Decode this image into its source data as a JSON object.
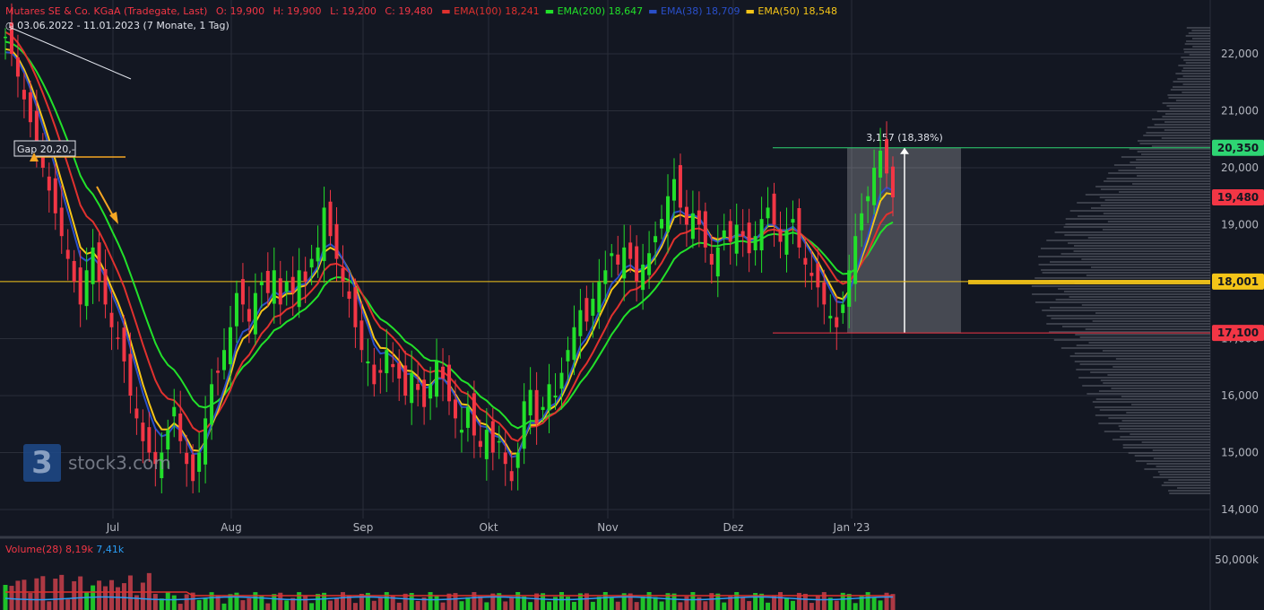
{
  "header": {
    "title": "Mutares SE & Co. KGaA (Tradegate, Last)",
    "open": "O: 19,900",
    "high": "H: 19,900",
    "low": "L: 19,200",
    "close": "C: 19,480",
    "indicators": [
      {
        "label": "EMA(100)",
        "value": "18,241",
        "color": "#e0312e"
      },
      {
        "label": "EMA(200)",
        "value": "18,647",
        "color": "#22e02a"
      },
      {
        "label": "EMA(38)",
        "value": "18,709",
        "color": "#2a4fc9"
      },
      {
        "label": "EMA(50)",
        "value": "18,548",
        "color": "#f5c518"
      }
    ],
    "range": "03.06.2022 - 11.01.2023",
    "period": "(7 Monate, 1 Tag)"
  },
  "volume_header": {
    "label": "Volume(28)",
    "value1": "8,19k",
    "value2": "7,41k"
  },
  "logo_text": "stock3.com",
  "chart_data": {
    "type": "candlestick",
    "title": "Mutares SE & Co. KGaA (Tradegate, Last)",
    "ylim": [
      13800,
      22600
    ],
    "y_ticks": [
      "22,000",
      "21,000",
      "20,000",
      "19,000",
      "18,000",
      "17,000",
      "16,000",
      "15,000",
      "14,000"
    ],
    "x_labels": [
      "Jul",
      "Aug",
      "Sep",
      "Okt",
      "Nov",
      "Dez",
      "Jan '23"
    ],
    "volume_tick": "50,000k",
    "close_path": [
      22.3,
      22.0,
      21.6,
      21.2,
      20.8,
      20.4,
      20.0,
      19.6,
      19.2,
      18.8,
      18.4,
      18.0,
      17.6,
      18.2,
      18.6,
      18.0,
      17.6,
      17.2,
      17.0,
      16.6,
      16.0,
      15.6,
      15.2,
      15.0,
      14.8,
      15.0,
      15.4,
      15.8,
      15.2,
      14.8,
      14.5,
      15.0,
      15.6,
      16.2,
      16.4,
      16.8,
      17.2,
      17.8,
      17.6,
      17.3,
      17.8,
      18.0,
      17.8,
      18.2,
      17.6,
      18.0,
      17.8,
      18.2,
      18.0,
      18.4,
      18.6,
      19.3,
      18.8,
      18.4,
      18.0,
      17.7,
      17.2,
      16.8,
      16.6,
      16.2,
      16.4,
      16.8,
      16.5,
      16.3,
      16.0,
      16.4,
      16.1,
      15.8,
      16.2,
      16.6,
      16.3,
      15.9,
      15.6,
      15.4,
      15.8,
      15.3,
      15.1,
      15.4,
      15.0,
      15.2,
      14.8,
      14.5,
      15.0,
      15.9,
      16.1,
      15.5,
      15.8,
      16.2,
      16.0,
      16.4,
      16.8,
      17.2,
      17.5,
      17.3,
      17.7,
      18.0,
      18.2,
      18.5,
      18.3,
      18.6,
      18.4,
      18.0,
      18.3,
      18.5,
      18.8,
      19.1,
      19.5,
      19.8,
      19.3,
      19.0,
      19.2,
      19.0,
      18.6,
      18.3,
      18.6,
      18.9,
      18.7,
      19.0,
      18.8,
      18.5,
      18.8,
      19.1,
      19.3,
      19.0,
      18.7,
      18.9,
      19.1,
      18.6,
      18.3,
      18.1,
      17.9,
      17.6,
      17.4,
      17.2,
      17.6,
      18.2,
      18.8,
      19.2,
      19.5,
      20.0,
      20.3,
      19.9,
      19.48
    ],
    "emas": [
      {
        "name": "EMA(200)",
        "value": "18,647"
      },
      {
        "name": "EMA(100)",
        "value": "18,241"
      },
      {
        "name": "EMA(50)",
        "value": "18,548"
      },
      {
        "name": "EMA(38)",
        "value": "18,709"
      }
    ],
    "levels": [
      {
        "label": "20,350",
        "value": 20350,
        "color": "#2ed573"
      },
      {
        "label": "19,480",
        "value": 19480,
        "color": "#f23645"
      },
      {
        "label": "18,001",
        "value": 18001,
        "color": "#f5c518"
      },
      {
        "label": "17,100",
        "value": 17100,
        "color": "#f23645"
      }
    ],
    "annotations": {
      "gap": "Gap 20,20,-",
      "measure": "3,157 (18,38%)"
    }
  }
}
